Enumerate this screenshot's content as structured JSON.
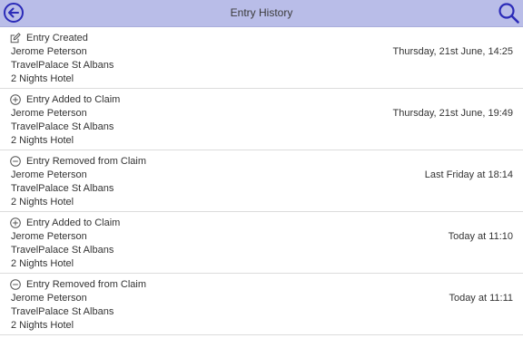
{
  "header": {
    "title": "Entry History",
    "back_icon": "back-arrow-icon",
    "search_icon": "search-icon",
    "accent": "#2b2bb8",
    "bar_color": "#b9bde8"
  },
  "entries": [
    {
      "action": "Entry Created",
      "icon": "edit-icon",
      "person": "Jerome Peterson",
      "location": "TravelPalace St Albans",
      "item": "2 Nights Hotel",
      "time": "Thursday, 21st June, 14:25"
    },
    {
      "action": "Entry Added to Claim",
      "icon": "plus-circle-icon",
      "person": "Jerome Peterson",
      "location": "TravelPalace St Albans",
      "item": "2 Nights Hotel",
      "time": "Thursday, 21st June, 19:49"
    },
    {
      "action": "Entry Removed from Claim",
      "icon": "minus-circle-icon",
      "person": "Jerome Peterson",
      "location": "TravelPalace St Albans",
      "item": "2 Nights Hotel",
      "time": "Last Friday at 18:14"
    },
    {
      "action": "Entry Added to Claim",
      "icon": "plus-circle-icon",
      "person": "Jerome Peterson",
      "location": "TravelPalace St Albans",
      "item": "2 Nights Hotel",
      "time": "Today at 11:10"
    },
    {
      "action": "Entry Removed from Claim",
      "icon": "minus-circle-icon",
      "person": "Jerome Peterson",
      "location": "TravelPalace St Albans",
      "item": "2 Nights Hotel",
      "time": "Today at 11:11"
    }
  ]
}
